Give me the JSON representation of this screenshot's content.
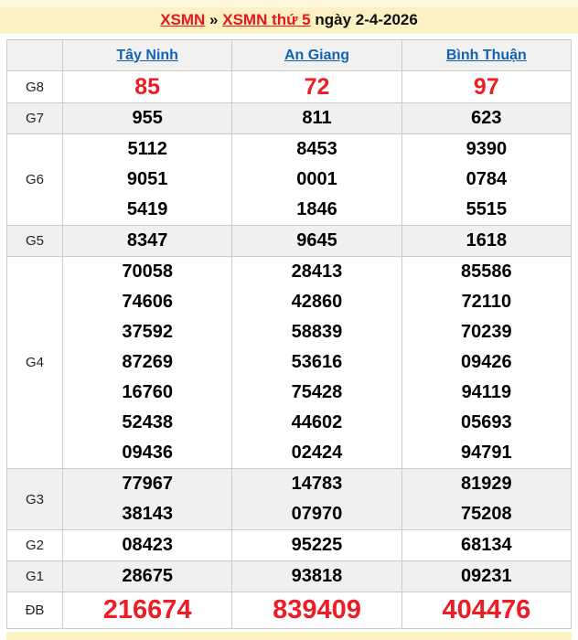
{
  "title": {
    "link_xsmn": "XSMN",
    "separator": "»",
    "link_day": "XSMN thứ 5",
    "date_text": "ngày 2-4-2026"
  },
  "table": {
    "columns": [
      "Tây Ninh",
      "An Giang",
      "Bình Thuận"
    ],
    "rows": [
      {
        "label": "G8",
        "style": "red-large",
        "values": [
          [
            "85"
          ],
          [
            "72"
          ],
          [
            "97"
          ]
        ]
      },
      {
        "label": "G7",
        "style": "normal",
        "values": [
          [
            "955"
          ],
          [
            "811"
          ],
          [
            "623"
          ]
        ]
      },
      {
        "label": "G6",
        "style": "normal",
        "values": [
          [
            "5112",
            "9051",
            "5419"
          ],
          [
            "8453",
            "0001",
            "1846"
          ],
          [
            "9390",
            "0784",
            "5515"
          ]
        ]
      },
      {
        "label": "G5",
        "style": "normal",
        "values": [
          [
            "8347"
          ],
          [
            "9645"
          ],
          [
            "1618"
          ]
        ]
      },
      {
        "label": "G4",
        "style": "normal",
        "values": [
          [
            "70058",
            "74606",
            "37592",
            "87269",
            "16760",
            "52438",
            "09436"
          ],
          [
            "28413",
            "42860",
            "58839",
            "53616",
            "75428",
            "44602",
            "02424"
          ],
          [
            "85586",
            "72110",
            "70239",
            "09426",
            "94119",
            "05693",
            "94791"
          ]
        ]
      },
      {
        "label": "G3",
        "style": "normal",
        "values": [
          [
            "77967",
            "38143"
          ],
          [
            "14783",
            "07970"
          ],
          [
            "81929",
            "75208"
          ]
        ]
      },
      {
        "label": "G2",
        "style": "normal",
        "values": [
          [
            "08423"
          ],
          [
            "95225"
          ],
          [
            "68134"
          ]
        ]
      },
      {
        "label": "G1",
        "style": "normal",
        "values": [
          [
            "28675"
          ],
          [
            "93818"
          ],
          [
            "09231"
          ]
        ]
      },
      {
        "label": "ĐB",
        "style": "red-xlarge",
        "values": [
          [
            "216674"
          ],
          [
            "839409"
          ],
          [
            "404476"
          ]
        ]
      }
    ]
  },
  "colors": {
    "accent_red": "#ee1c25",
    "link_blue": "#1263b2",
    "banner_yellow": "#fbf1c3",
    "banner_yellow_light": "#fdf8dd",
    "row_alt_gray": "#f0f0f0"
  }
}
